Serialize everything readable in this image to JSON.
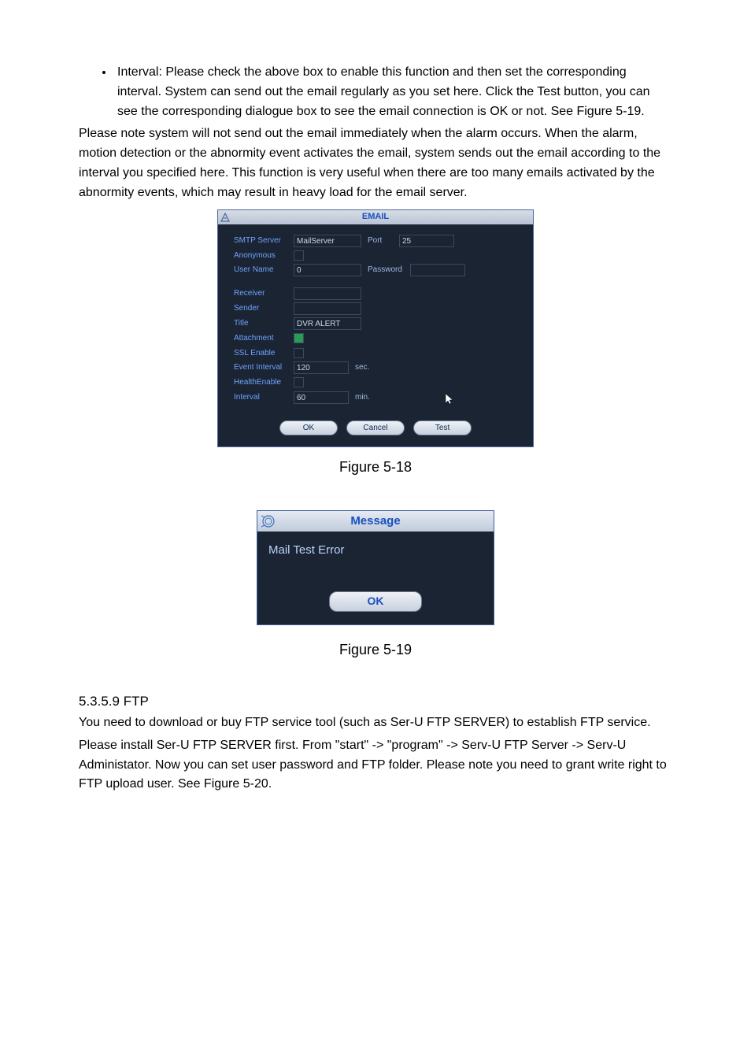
{
  "body": {
    "bullet_text": "Interval: Please check the above box to enable this function and then set the corresponding interval. System can send out the email regularly as you set here. Click the Test button, you can see the corresponding dialogue box to see the email connection is OK or not.  See Figure 5-19.",
    "para_note": "Please note system will not send out the email immediately when the alarm occurs. When the alarm, motion detection or the abnormity event activates the email, system sends out the email according to the interval you specified here. This function is very useful when there are too many emails activated by the abnormity events, which may result in heavy load for the email server."
  },
  "email_dialog": {
    "title": "EMAIL",
    "labels": {
      "smtp": "SMTP Server",
      "port": "Port",
      "anonymous": "Anonymous",
      "username": "User Name",
      "password": "Password",
      "receiver": "Receiver",
      "sender": "Sender",
      "title_lbl": "Title",
      "attachment": "Attachment",
      "ssl_enable": "SSL Enable",
      "event_interval": "Event Interval",
      "health_enable": "HealthEnable",
      "interval": "Interval",
      "sec": "sec.",
      "min": "min."
    },
    "values": {
      "smtp": "MailServer",
      "port": "25",
      "username": "0",
      "password": "",
      "receiver": "",
      "sender": "",
      "title": "DVR ALERT",
      "event_interval": "120",
      "interval": "60"
    },
    "buttons": {
      "ok": "OK",
      "cancel": "Cancel",
      "test": "Test"
    }
  },
  "caption_518": "Figure 5-18",
  "msg_dialog": {
    "title": "Message",
    "body": "Mail Test Error",
    "ok": "OK"
  },
  "caption_519": "Figure 5-19",
  "ftp": {
    "heading": "5.3.5.9  FTP",
    "p1": "You need to download or buy FTP service tool (such as Ser-U FTP SERVER) to establish FTP service.",
    "p2": "Please install Ser-U FTP SERVER first. From \"start\" -> \"program\" -> Serv-U FTP Server -> Serv-U Administator. Now you can set user password and FTP folder. Please note you need to grant write right to FTP upload user. See Figure 5-20."
  }
}
